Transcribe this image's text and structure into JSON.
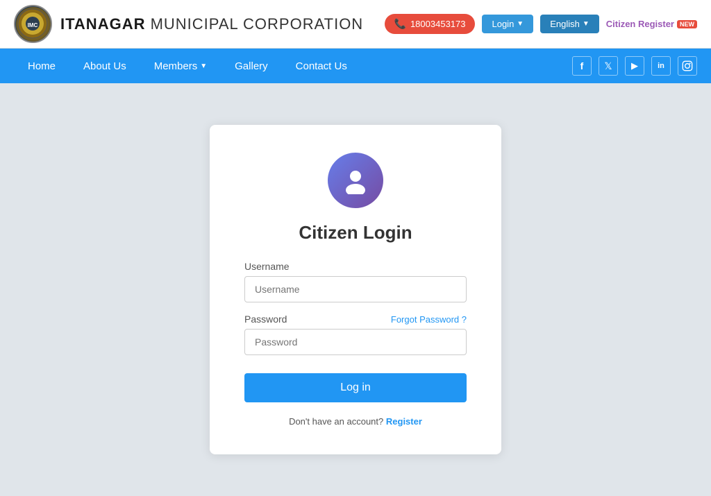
{
  "header": {
    "org_name_bold": "ITANAGAR",
    "org_name_rest": " MUNICIPAL CORPORATION",
    "phone": "18003453173",
    "login_label": "Login",
    "language_label": "English",
    "citizen_register_label": "Citizen Register",
    "new_badge": "NEW"
  },
  "nav": {
    "links": [
      {
        "label": "Home",
        "id": "home"
      },
      {
        "label": "About Us",
        "id": "about"
      },
      {
        "label": "Members",
        "id": "members",
        "has_dropdown": true
      },
      {
        "label": "Gallery",
        "id": "gallery"
      },
      {
        "label": "Contact Us",
        "id": "contact"
      }
    ],
    "social": [
      {
        "icon": "f",
        "name": "facebook"
      },
      {
        "icon": "t",
        "name": "twitter"
      },
      {
        "icon": "▶",
        "name": "youtube"
      },
      {
        "icon": "in",
        "name": "linkedin"
      },
      {
        "icon": "📷",
        "name": "instagram"
      }
    ]
  },
  "login_form": {
    "title": "Citizen Login",
    "username_label": "Username",
    "username_placeholder": "Username",
    "password_label": "Password",
    "password_placeholder": "Password",
    "forgot_password": "Forgot Password ?",
    "login_button": "Log in",
    "no_account_text": "Don't have an account?",
    "register_link": "Register"
  }
}
